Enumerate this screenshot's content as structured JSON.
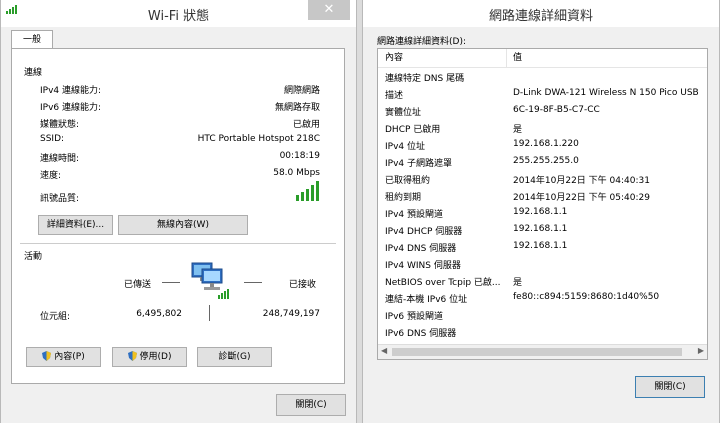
{
  "left": {
    "title": "Wi-Fi 狀態",
    "tab": "一般",
    "connection_section": "連線",
    "rows": [
      {
        "label": "IPv4 連線能力:",
        "value": "網際網路"
      },
      {
        "label": "IPv6 連線能力:",
        "value": "無網路存取"
      },
      {
        "label": "媒體狀態:",
        "value": "已啟用"
      },
      {
        "label": "SSID:",
        "value": "HTC Portable Hotspot 218C"
      },
      {
        "label": "連線時間:",
        "value": "00:18:19"
      },
      {
        "label": "速度:",
        "value": "58.0 Mbps"
      }
    ],
    "signal_label": "訊號品質:",
    "details_button": "詳細資料(E)...",
    "wireless_button": "無線內容(W)",
    "activity_section": "活動",
    "sent_label": "已傳送",
    "received_label": "已接收",
    "bytes_label": "位元組:",
    "bytes_sent": "6,495,802",
    "bytes_received": "248,749,197",
    "properties_button": "內容(P)",
    "disable_button": "停用(D)",
    "diagnose_button": "診斷(G)",
    "close_button": "關閉(C)"
  },
  "right": {
    "title": "網路連線詳細資料",
    "list_label": "網路連線詳細資料(D):",
    "col_property": "內容",
    "col_value": "值",
    "rows": [
      {
        "p": "連線特定 DNS 尾碼",
        "v": ""
      },
      {
        "p": "描述",
        "v": "D-Link DWA-121 Wireless N 150 Pico USB"
      },
      {
        "p": "實體位址",
        "v": "6C-19-8F-B5-C7-CC"
      },
      {
        "p": "DHCP 已啟用",
        "v": "是"
      },
      {
        "p": "IPv4 位址",
        "v": "192.168.1.220"
      },
      {
        "p": "IPv4 子網路遮罩",
        "v": "255.255.255.0"
      },
      {
        "p": "已取得租約",
        "v": "2014年10月22日 下午 04:40:31"
      },
      {
        "p": "租約到期",
        "v": "2014年10月22日 下午 05:40:29"
      },
      {
        "p": "IPv4 預設閘道",
        "v": "192.168.1.1"
      },
      {
        "p": "IPv4 DHCP 伺服器",
        "v": "192.168.1.1"
      },
      {
        "p": "IPv4 DNS 伺服器",
        "v": "192.168.1.1"
      },
      {
        "p": "IPv4 WINS 伺服器",
        "v": ""
      },
      {
        "p": "NetBIOS over Tcpip 已啟...",
        "v": "是"
      },
      {
        "p": "連結-本機 IPv6 位址",
        "v": "fe80::c894:5159:8680:1d40%50"
      },
      {
        "p": "IPv6 預設閘道",
        "v": ""
      },
      {
        "p": "IPv6 DNS 伺服器",
        "v": ""
      }
    ],
    "close_button": "關閉(C)"
  },
  "colors": {
    "signal": "#2a9d2a",
    "shield_blue": "#2f6fc1",
    "shield_yellow": "#f0c020"
  },
  "icons": [
    "signal-bars-icon",
    "network-computers-icon",
    "shield-icon",
    "close-x-icon"
  ]
}
